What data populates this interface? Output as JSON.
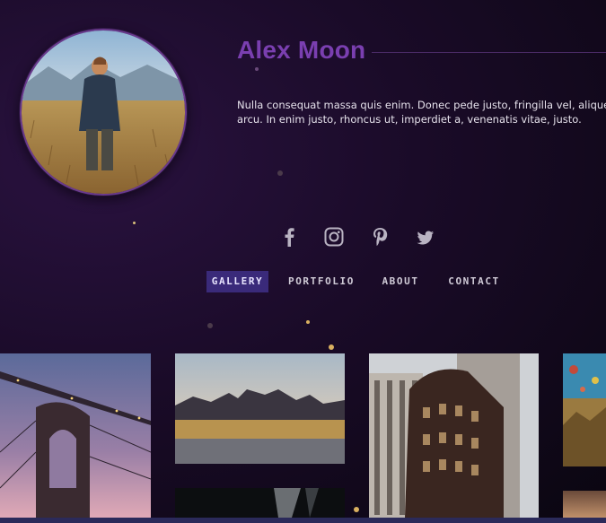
{
  "profile": {
    "name": "Alex Moon",
    "bio_line1": "Nulla consequat massa quis enim. Donec pede justo, fringilla vel, aliquet n",
    "bio_line2": "arcu. In enim justo, rhoncus ut, imperdiet a, venenatis vitae, justo."
  },
  "social": [
    {
      "icon": "facebook-icon"
    },
    {
      "icon": "instagram-icon"
    },
    {
      "icon": "pinterest-icon"
    },
    {
      "icon": "twitter-icon"
    }
  ],
  "nav": {
    "items": [
      {
        "label": "GALLERY",
        "active": true
      },
      {
        "label": "PORTFOLIO",
        "active": false
      },
      {
        "label": "ABOUT",
        "active": false
      },
      {
        "label": "CONTACT",
        "active": false
      }
    ]
  },
  "gallery": {
    "images": [
      {
        "subject": "bridge"
      },
      {
        "subject": "desert-mesa"
      },
      {
        "subject": "buildings"
      },
      {
        "subject": "balloons"
      },
      {
        "subject": "dark-tunnel"
      },
      {
        "subject": "sunset"
      }
    ]
  },
  "colors": {
    "accent": "#7a3fb0",
    "nav_active_bg": "#3a2a7a",
    "background": "#1a0b28"
  }
}
